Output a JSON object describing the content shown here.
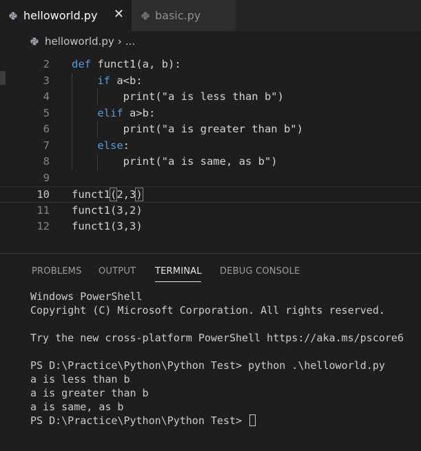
{
  "tabs": [
    {
      "label": "helloworld.py",
      "active": true,
      "close_glyph": "✕"
    },
    {
      "label": "basic.py",
      "active": false
    }
  ],
  "breadcrumb": {
    "file": "helloworld.py",
    "separator": "›",
    "more": "..."
  },
  "editor": {
    "lines": [
      {
        "num": "2",
        "text": "def funct1(a, b):"
      },
      {
        "num": "3",
        "text": "    if a<b:"
      },
      {
        "num": "4",
        "text": "        print(\"a is less than b\")"
      },
      {
        "num": "5",
        "text": "    elif a>b:"
      },
      {
        "num": "6",
        "text": "        print(\"a is greater than b\")"
      },
      {
        "num": "7",
        "text": "    else:"
      },
      {
        "num": "8",
        "text": "        print(\"a is same, as b\")"
      },
      {
        "num": "9",
        "text": ""
      },
      {
        "num": "10",
        "text": "funct1(2,3)",
        "current": true
      },
      {
        "num": "11",
        "text": "funct1(3,2)"
      },
      {
        "num": "12",
        "text": "funct1(3,3)"
      }
    ]
  },
  "panel": {
    "tabs": [
      "PROBLEMS",
      "OUTPUT",
      "TERMINAL",
      "DEBUG CONSOLE"
    ],
    "active_tab": "TERMINAL",
    "terminal_lines": [
      "Windows PowerShell",
      "Copyright (C) Microsoft Corporation. All rights reserved.",
      "",
      "Try the new cross-platform PowerShell https://aka.ms/pscore6",
      "",
      "PS D:\\Practice\\Python\\Python Test> python .\\helloworld.py",
      "a is less than b",
      "a is greater than b",
      "a is same, as b"
    ],
    "prompt": "PS D:\\Practice\\Python\\Python Test> "
  },
  "colors": {
    "background": "#1e1e1e",
    "keyword": "#569cd6",
    "text": "#d4d4d4",
    "tabbar": "#252526"
  }
}
